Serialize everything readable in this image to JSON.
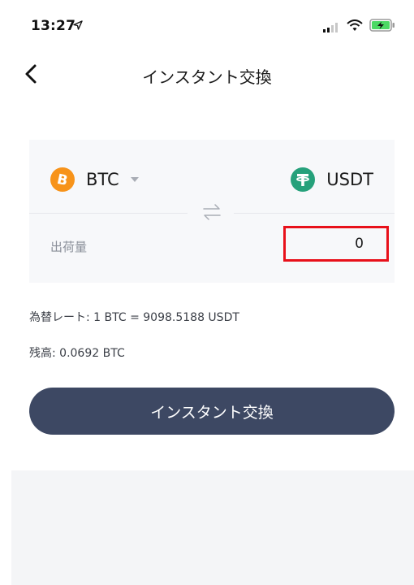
{
  "status_bar": {
    "time": "13:27",
    "icons": [
      "location-arrow-icon",
      "signal-icon",
      "wifi-icon",
      "battery-charging-icon"
    ]
  },
  "nav": {
    "back_icon": "chevron-left-icon",
    "title": "インスタント交換"
  },
  "swap": {
    "from_coin": {
      "symbol": "BTC",
      "icon": "bitcoin-icon",
      "icon_glyph": "B",
      "color": "#f7931a"
    },
    "to_coin": {
      "symbol": "USDT",
      "icon": "tether-icon",
      "icon_glyph": "T",
      "color": "#26a17b"
    },
    "swap_icon": "swap-arrows-icon",
    "amount_label": "出荷量",
    "amount_value": "0"
  },
  "info": {
    "rate_label": "為替レート:",
    "rate_value": "1 BTC = 9098.5188 USDT",
    "balance_label": "残高:",
    "balance_value": "0.0692 BTC"
  },
  "action": {
    "exchange_label": "インスタント交換"
  },
  "colors": {
    "accent_button": "#3d4863",
    "highlight_border": "#e8101a",
    "card_bg": "#f7f8fa",
    "battery_charging": "#4cd964"
  }
}
